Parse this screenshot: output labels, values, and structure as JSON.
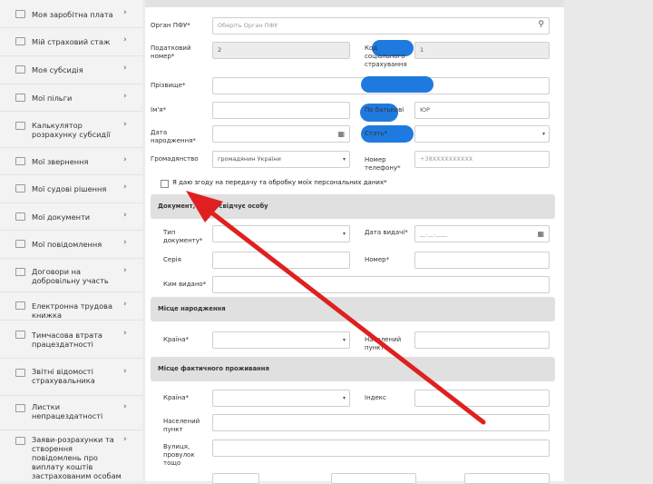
{
  "sidebar": {
    "items": [
      {
        "label": "Моя заробітна плата",
        "icon": "salary-icon"
      },
      {
        "label": "Мій страховий стаж",
        "icon": "calendar-icon"
      },
      {
        "label": "Моя субсидія",
        "icon": "grid-icon"
      },
      {
        "label": "Мої пільги",
        "icon": "grid-icon"
      },
      {
        "label": "Калькулятор розрахунку субсидії",
        "icon": "calculator-icon"
      },
      {
        "label": "Мої звернення",
        "icon": "message-icon"
      },
      {
        "label": "Мої судові рішення",
        "icon": "document-icon"
      },
      {
        "label": "Мої документи",
        "icon": "document-icon"
      },
      {
        "label": "Мої повідомлення",
        "icon": "envelope-icon"
      },
      {
        "label": "Договори на добровільну участь",
        "icon": "contract-icon"
      },
      {
        "label": "Електронна трудова книжка",
        "icon": "book-icon"
      },
      {
        "label": "Тимчасова втрата працездатності",
        "icon": "book-icon"
      },
      {
        "label": "Звітні відомості страхувальника",
        "icon": "report-icon"
      },
      {
        "label": "Листки непрацездатності",
        "icon": "book-icon"
      },
      {
        "label": "Заяви-розрахунки та створення повідомлень про виплату коштів застрахованим особам",
        "icon": "book-icon"
      }
    ],
    "chevron": "›"
  },
  "form": {
    "organ_label": "Орган ПФУ*",
    "organ_placeholder": "Оберіть Орган ПФУ",
    "tax_label": "Податковий номер*",
    "tax_value": "2",
    "ins_code_label": "Код соціального страхування",
    "ins_code_value": "1",
    "surname_label": "Прізвище*",
    "name_label": "Ім'я*",
    "patronymic_label": "По батькові",
    "patronymic_value": "ЮР",
    "birth_label": "Дата народження*",
    "sex_label": "Стать*",
    "citizenship_label": "Громадянство",
    "citizenship_value": "громадянин України",
    "phone_label": "Номер телефону*",
    "phone_placeholder": "+38XXXXXXXXXX",
    "consent_label": "Я даю згоду на передачу та обробку моїх персональних даних*",
    "section_id": "Документ, що посвідчує особу",
    "doc_type_label": "Тип документу*",
    "issue_date_label": "Дата видачі*",
    "issue_date_placeholder": "__.__.____",
    "series_label": "Серія",
    "number_label": "Номер*",
    "issued_by_label": "Ким видано*",
    "section_birth": "Місце народження",
    "country_label": "Країна*",
    "settlement_label": "Населений пункт*",
    "section_residence": "Місце фактичного проживання",
    "country2_label": "Країна*",
    "index_label": "Індекс",
    "settlement2_label": "Населений пункт",
    "street_label": "Вулиця, провулок тощо"
  },
  "colors": {
    "accent": "#3a9a4a",
    "arrow": "#e02020",
    "redaction": "#1f7ae0"
  }
}
